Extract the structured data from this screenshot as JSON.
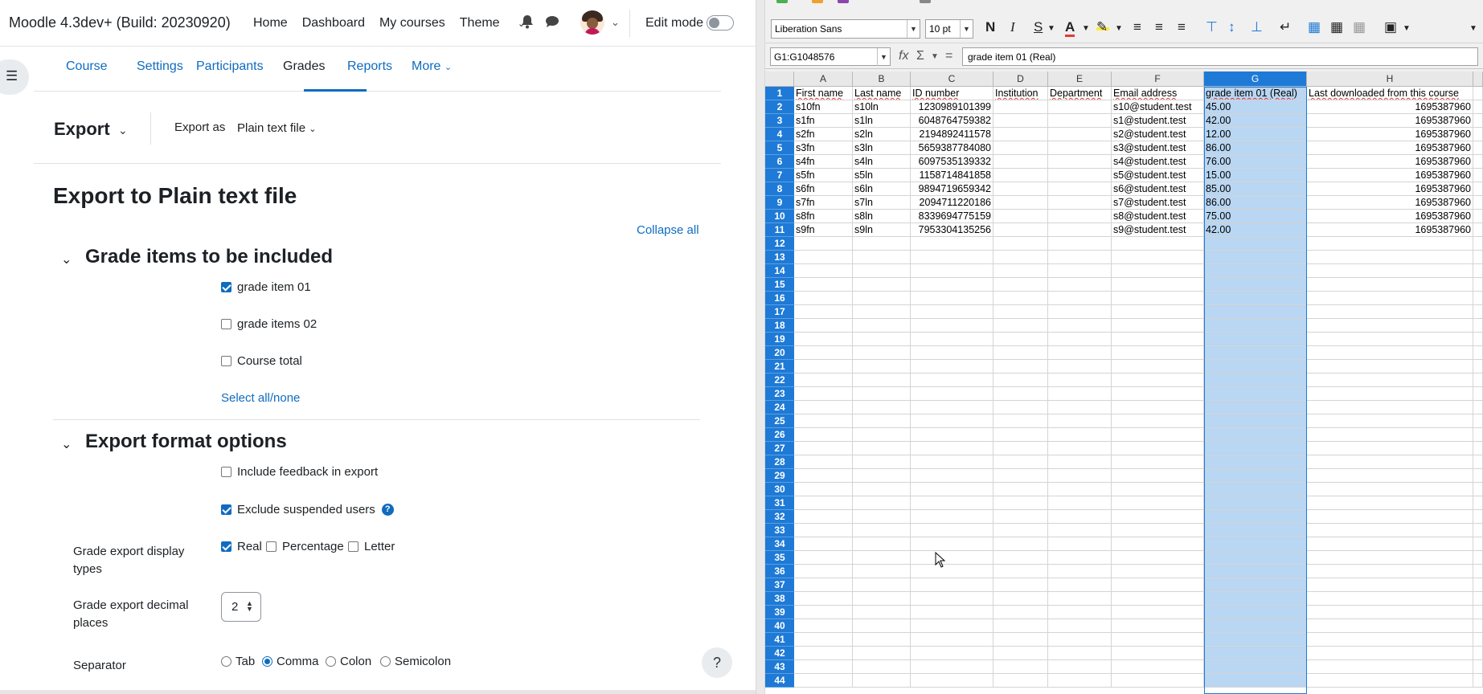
{
  "moodle": {
    "brand": "Moodle 4.3dev+ (Build: 20230920)",
    "topnav": [
      "Home",
      "Dashboard",
      "My courses",
      "Theme"
    ],
    "edit_mode": "Edit mode",
    "secnav": [
      "Course",
      "Settings",
      "Participants",
      "Grades",
      "Reports",
      "More"
    ],
    "active_tab": "Grades",
    "export_label": "Export",
    "export_as_label": "Export as",
    "export_as_value": "Plain text file",
    "page_heading": "Export to Plain text file",
    "collapse_all": "Collapse all",
    "grade_items": {
      "heading": "Grade items to be included",
      "items": [
        {
          "label": "grade item 01",
          "checked": true
        },
        {
          "label": "grade items 02",
          "checked": false
        },
        {
          "label": "Course total",
          "checked": false
        }
      ],
      "select_all": "Select all/none"
    },
    "format_options": {
      "heading": "Export format options",
      "include_feedback": {
        "label": "Include feedback in export",
        "checked": false
      },
      "exclude_suspended": {
        "label": "Exclude suspended users",
        "checked": true
      },
      "display_types_label": "Grade export display types",
      "display_types": [
        {
          "label": "Real",
          "checked": true
        },
        {
          "label": "Percentage",
          "checked": false
        },
        {
          "label": "Letter",
          "checked": false
        }
      ],
      "decimal_label": "Grade export decimal places",
      "decimal_value": "2",
      "separator_label": "Separator",
      "separators": [
        {
          "label": "Tab",
          "selected": false
        },
        {
          "label": "Comma",
          "selected": true
        },
        {
          "label": "Colon",
          "selected": false
        },
        {
          "label": "Semicolon",
          "selected": false
        }
      ]
    },
    "help_button": "?"
  },
  "calc": {
    "font_name": "Liberation Sans",
    "font_size": "10 pt",
    "bold": "N",
    "italic": "I",
    "underline": "S",
    "name_box": "G1:G1048576",
    "formula_content": "grade item 01 (Real)",
    "selected_column": "G",
    "columns": [
      "A",
      "B",
      "C",
      "D",
      "E",
      "F",
      "G",
      "H"
    ],
    "rows": [
      [
        "First name",
        "Last name",
        "ID number",
        "Institution",
        "Department",
        "Email address",
        "grade item 01 (Real)",
        "Last downloaded from this course"
      ],
      [
        "s10fn",
        "s10ln",
        "1230989101399",
        "",
        "",
        "s10@student.test",
        "45.00",
        "1695387960"
      ],
      [
        "s1fn",
        "s1ln",
        "6048764759382",
        "",
        "",
        "s1@student.test",
        "42.00",
        "1695387960"
      ],
      [
        "s2fn",
        "s2ln",
        "2194892411578",
        "",
        "",
        "s2@student.test",
        "12.00",
        "1695387960"
      ],
      [
        "s3fn",
        "s3ln",
        "5659387784080",
        "",
        "",
        "s3@student.test",
        "86.00",
        "1695387960"
      ],
      [
        "s4fn",
        "s4ln",
        "6097535139332",
        "",
        "",
        "s4@student.test",
        "76.00",
        "1695387960"
      ],
      [
        "s5fn",
        "s5ln",
        "1158714841858",
        "",
        "",
        "s5@student.test",
        "15.00",
        "1695387960"
      ],
      [
        "s6fn",
        "s6ln",
        "9894719659342",
        "",
        "",
        "s6@student.test",
        "85.00",
        "1695387960"
      ],
      [
        "s7fn",
        "s7ln",
        "2094711220186",
        "",
        "",
        "s7@student.test",
        "86.00",
        "1695387960"
      ],
      [
        "s8fn",
        "s8ln",
        "8339694775159",
        "",
        "",
        "s8@student.test",
        "75.00",
        "1695387960"
      ],
      [
        "s9fn",
        "s9ln",
        "7953304135256",
        "",
        "",
        "s9@student.test",
        "42.00",
        "1695387960"
      ]
    ],
    "row_count_visible": 44,
    "colors": {
      "selection": "#1e7ad6",
      "selection_fill": "#b9d6f2"
    }
  }
}
